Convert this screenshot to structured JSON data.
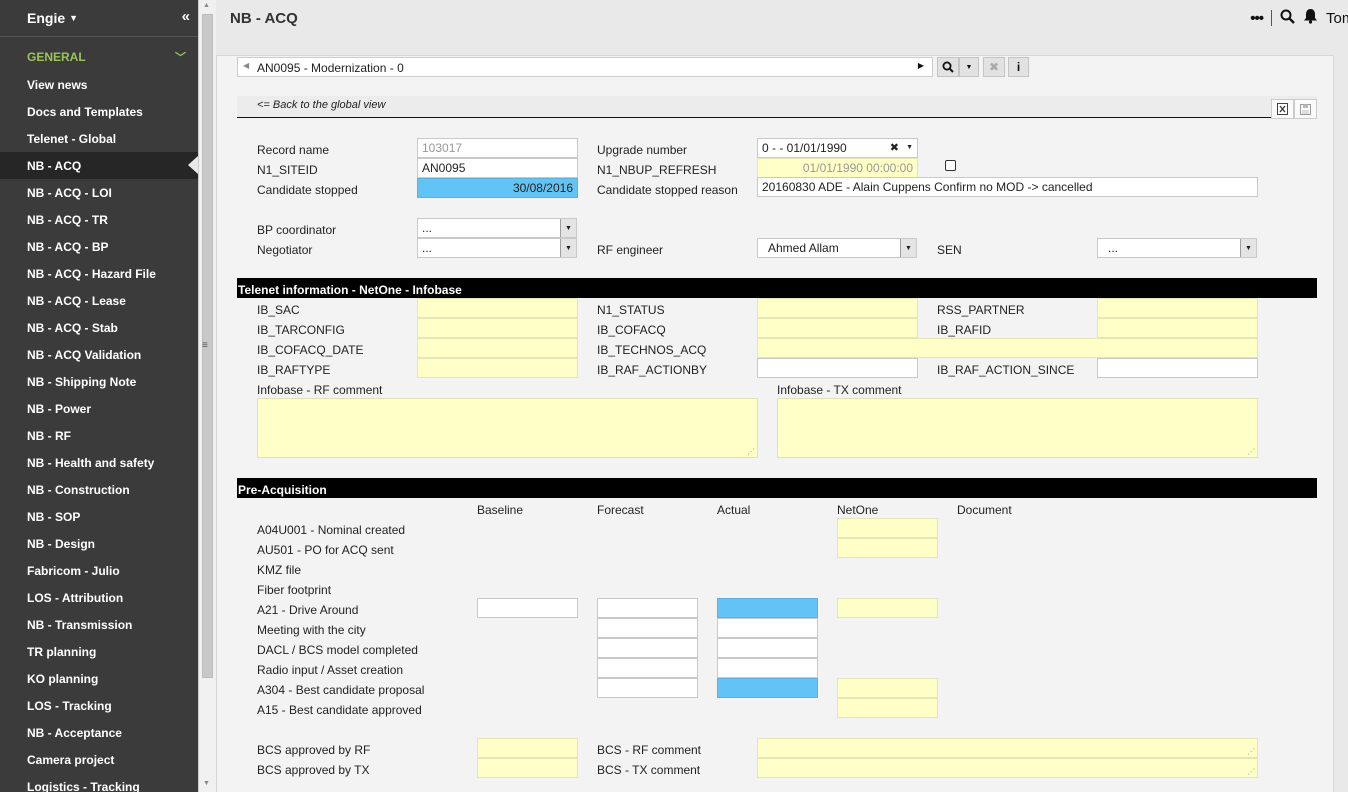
{
  "sidebar": {
    "brand": "Engie",
    "collapse_glyph": "«",
    "group": "GENERAL",
    "items": [
      {
        "label": "View news"
      },
      {
        "label": "Docs and Templates"
      },
      {
        "label": "Telenet - Global"
      },
      {
        "label": "NB - ACQ"
      },
      {
        "label": "NB - ACQ - LOI"
      },
      {
        "label": "NB - ACQ - TR"
      },
      {
        "label": "NB - ACQ - BP"
      },
      {
        "label": "NB - ACQ - Hazard File"
      },
      {
        "label": "NB - ACQ - Lease"
      },
      {
        "label": "NB - ACQ - Stab"
      },
      {
        "label": "NB - ACQ Validation"
      },
      {
        "label": "NB - Shipping Note"
      },
      {
        "label": "NB - Power"
      },
      {
        "label": "NB - RF"
      },
      {
        "label": "NB - Health and safety"
      },
      {
        "label": "NB - Construction"
      },
      {
        "label": "NB - SOP"
      },
      {
        "label": "NB - Design"
      },
      {
        "label": "Fabricom - Julio"
      },
      {
        "label": "LOS - Attribution"
      },
      {
        "label": "NB - Transmission"
      },
      {
        "label": "TR planning"
      },
      {
        "label": "KO planning"
      },
      {
        "label": "LOS - Tracking"
      },
      {
        "label": "NB - Acceptance"
      },
      {
        "label": "Camera project"
      },
      {
        "label": "Logistics - Tracking"
      }
    ]
  },
  "topbar": {
    "title": "NB - ACQ",
    "user": "Tom"
  },
  "toolbar": {
    "record_selector": "AN0095 - Modernization - 0",
    "back_link": "<= Back to the global view"
  },
  "header_fields": {
    "record_name_label": "Record name",
    "record_name_value": "103017",
    "n1_siteid_label": "N1_SITEID",
    "n1_siteid_value": "AN0095",
    "candidate_stopped_label": "Candidate stopped",
    "candidate_stopped_value": "30/08/2016",
    "upgrade_number_label": "Upgrade number",
    "upgrade_number_value": "0 - - 01/01/1990",
    "nbup_refresh_label": "N1_NBUP_REFRESH",
    "nbup_refresh_value": "01/01/1990 00:00:00",
    "candidate_stopped_reason_label": "Candidate stopped reason",
    "candidate_stopped_reason_value": "20160830 ADE - Alain Cuppens Confirm no MOD -> cancelled",
    "bp_coordinator_label": "BP coordinator",
    "bp_coordinator_value": "...",
    "negotiator_label": "Negotiator",
    "negotiator_value": "...",
    "rf_engineer_label": "RF engineer",
    "rf_engineer_value": "Ahmed Allam",
    "sen_label": "SEN",
    "sen_value": "..."
  },
  "infobase": {
    "section_title": "Telenet information - NetOne - Infobase",
    "ib_sac": "IB_SAC",
    "ib_tarconfig": "IB_TARCONFIG",
    "ib_cofacq_date": "IB_COFACQ_DATE",
    "ib_raftype": "IB_RAFTYPE",
    "n1_status": "N1_STATUS",
    "ib_cofacq": "IB_COFACQ",
    "ib_technos_acq": "IB_TECHNOS_ACQ",
    "ib_raf_actionby": "IB_RAF_ACTIONBY",
    "rss_partner": "RSS_PARTNER",
    "ib_rafid": "IB_RAFID",
    "ib_raf_action_since": "IB_RAF_ACTION_SINCE",
    "rf_comment": "Infobase - RF comment",
    "tx_comment": "Infobase - TX comment"
  },
  "preacq": {
    "section_title": "Pre-Acquisition",
    "columns": [
      "Baseline",
      "Forecast",
      "Actual",
      "NetOne",
      "Document"
    ],
    "rows": [
      "A04U001 - Nominal created",
      "AU501 - PO for ACQ sent",
      "KMZ file",
      "Fiber footprint",
      "A21 - Drive Around",
      "Meeting with the city",
      "DACL / BCS model completed",
      "Radio input / Asset creation",
      "A304 - Best candidate proposal",
      "A15 - Best candidate approved"
    ],
    "bcs_rf_label": "BCS approved by RF",
    "bcs_tx_label": "BCS approved by TX",
    "bcs_rf_comment_label": "BCS - RF comment",
    "bcs_tx_comment_label": "BCS - TX comment"
  },
  "colors": {
    "sidebar_bg": "#3b3b3b",
    "accent_green": "#9bc35a",
    "highlight_blue": "#64c3f5",
    "readonly_yellow": "#ffffc8"
  }
}
